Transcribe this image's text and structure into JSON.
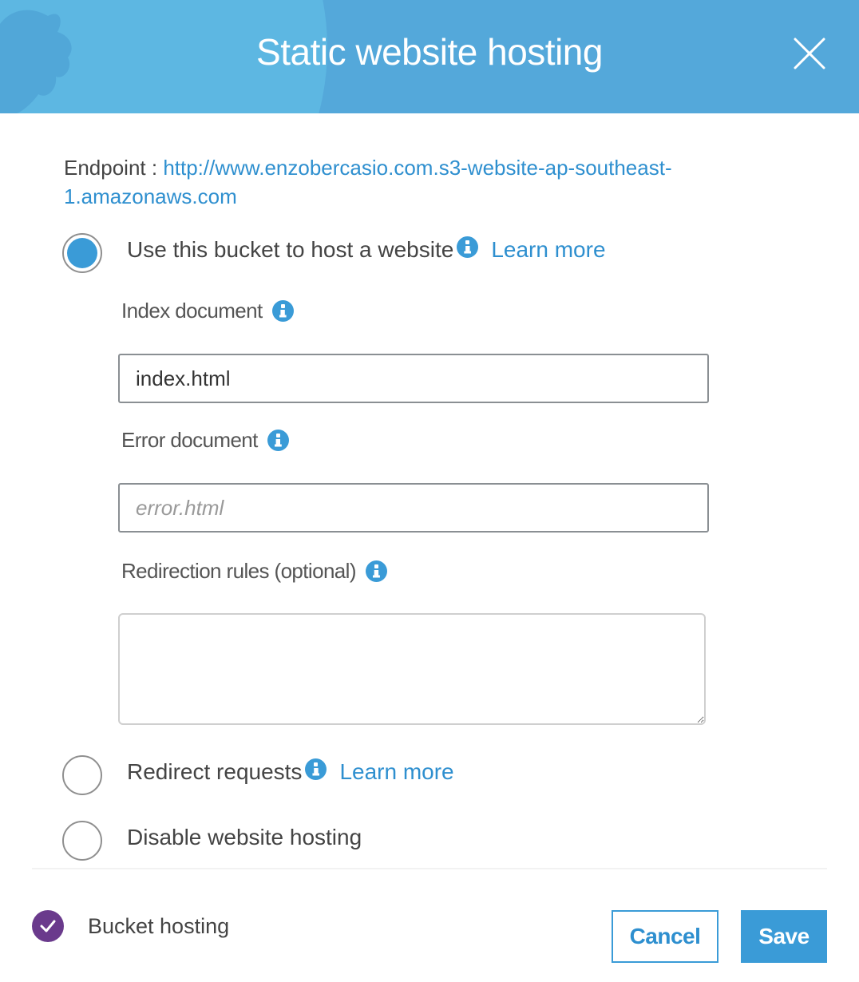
{
  "dialog": {
    "title": "Static website hosting",
    "close_icon": "close-icon"
  },
  "endpoint": {
    "label": "Endpoint : ",
    "url": "http://www.enzobercasio.com.s3-website-ap-southeast-1.amazonaws.com"
  },
  "options": [
    {
      "label": "Use this bucket to host a website",
      "learn_more": "Learn more",
      "selected": true
    },
    {
      "label": "Redirect requests",
      "learn_more": "Learn more",
      "selected": false
    },
    {
      "label": "Disable website hosting",
      "selected": false
    }
  ],
  "fields": {
    "index": {
      "label": "Index document",
      "value": "index.html",
      "placeholder": ""
    },
    "error": {
      "label": "Error document",
      "value": "",
      "placeholder": "error.html"
    },
    "redirection": {
      "label": "Redirection rules (optional)",
      "value": ""
    }
  },
  "footer": {
    "status_text": "Bucket hosting",
    "cancel_label": "Cancel",
    "save_label": "Save"
  },
  "colors": {
    "header_bg": "#54a8da",
    "accent": "#3a9bd7",
    "link": "#2e8fcf",
    "status_check": "#6a3a8c"
  }
}
